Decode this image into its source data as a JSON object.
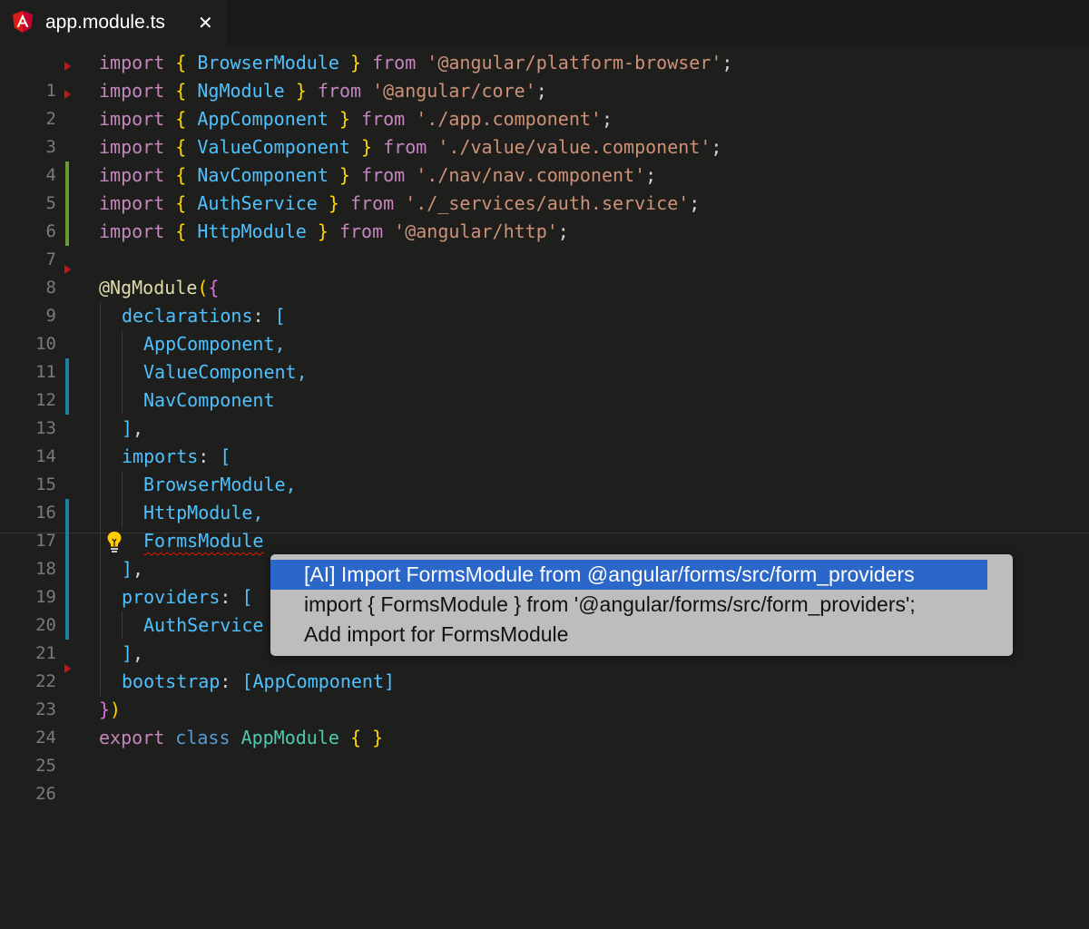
{
  "tab": {
    "file_name": "app.module.ts",
    "close_glyph": "✕",
    "icon": "angular-logo-icon"
  },
  "colors": {
    "keyword": "#c586c0",
    "string": "#ce9178",
    "identifier": "#4fc1ff",
    "class_name": "#4ec9b0",
    "bracket": "#ffd700",
    "selection": "#2b66c9"
  },
  "gutter": {
    "line_numbers": [
      "1",
      "2",
      "3",
      "4",
      "5",
      "6",
      "7",
      "8",
      "9",
      "10",
      "11",
      "12",
      "13",
      "14",
      "15",
      "16",
      "17",
      "18",
      "19",
      "20",
      "21",
      "22",
      "23",
      "24",
      "25",
      "26"
    ]
  },
  "code": {
    "kw_import": "import",
    "kw_from": "from",
    "ob": "{ ",
    "cb": " }",
    "semi": ";",
    "l1_id": "BrowserModule",
    "l1_str": "'@angular/platform-browser'",
    "l2_id": "NgModule",
    "l2_str": "'@angular/core'",
    "l3_id": "AppComponent",
    "l3_str": "'./app.component'",
    "l4_id": "ValueComponent",
    "l4_str": "'./value/value.component'",
    "l5_id": "NavComponent",
    "l5_str": "'./nav/nav.component'",
    "l6_id": "AuthService",
    "l6_str": "'./_services/auth.service'",
    "l7_id": "HttpModule",
    "l7_str": "'@angular/http'",
    "l9_dec": "@NgModule",
    "l9_paren": "(",
    "l9_brace": "{",
    "l10_prop": "declarations",
    "l10_rest": ": ",
    "l10_bkt": "[",
    "l11": "AppComponent,",
    "l12": "ValueComponent,",
    "l13": "NavComponent",
    "l14_bkt": "]",
    "l14_comma": ",",
    "l15_prop": "imports",
    "l15_rest": ": ",
    "l15_bkt": "[",
    "l16": "BrowserModule,",
    "l17": "HttpModule,",
    "l18": "FormsModule",
    "l19_bkt": "]",
    "l19_comma": ",",
    "l20_prop": "providers",
    "l20_rest": ": ",
    "l20_bkt": "[",
    "l21": "AuthService",
    "l22_bkt": "]",
    "l22_comma": ",",
    "l23_prop": "bootstrap",
    "l23_rest": ": ",
    "l23_val": "[AppComponent]",
    "l24_brace": "}",
    "l24_paren": ")",
    "l25_export": "export",
    "l25_class": "class",
    "l25_name": "AppModule",
    "l25_braces": "{ }"
  },
  "lightbulb_icon": "lightbulb-icon",
  "quick_fix": {
    "items": [
      "[AI] Import FormsModule from @angular/forms/src/form_providers",
      "import { FormsModule } from '@angular/forms/src/form_providers';",
      "Add import for FormsModule"
    ],
    "selected_index": 0
  }
}
